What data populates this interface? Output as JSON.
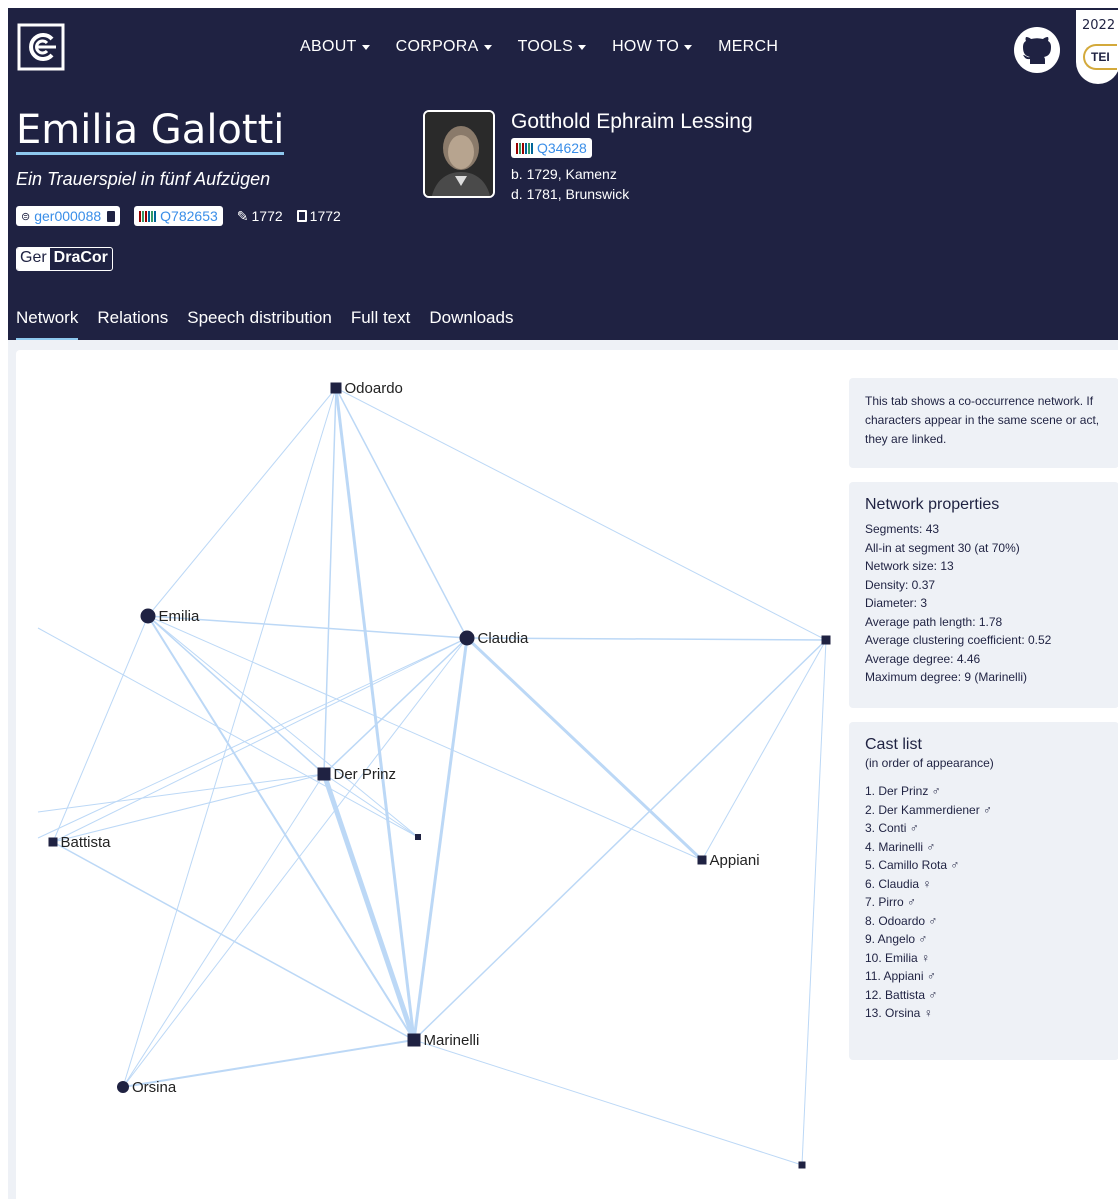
{
  "nav": {
    "items": [
      "ABOUT",
      "CORPORA",
      "TOOLS",
      "HOW TO",
      "MERCH"
    ],
    "has_caret": [
      true,
      true,
      true,
      true,
      false
    ]
  },
  "badge": {
    "year": "2022",
    "label": "TEI"
  },
  "play": {
    "title": "Emilia Galotti",
    "subtitle": "Ein Trauerspiel in fünf Aufzügen",
    "id": "ger000088",
    "wikidata": "Q782653",
    "written": "1772",
    "printed": "1772",
    "corpus_prefix": "Ger",
    "corpus_name": "DraCor"
  },
  "author": {
    "name": "Gotthold Ephraim Lessing",
    "wikidata": "Q34628",
    "born": "b. 1729, Kamenz",
    "died": "d. 1781, Brunswick"
  },
  "tabs": [
    "Network",
    "Relations",
    "Speech distribution",
    "Full text",
    "Downloads"
  ],
  "info": {
    "text": "This tab shows a co-occurrence network. If characters appear in the same scene or act, they are linked."
  },
  "network_properties": {
    "heading": "Network properties",
    "lines": [
      "Segments: 43",
      "All-in at segment 30 (at 70%)",
      "Network size: 13",
      "Density: 0.37",
      "Diameter: 3",
      "Average path length: 1.78",
      "Average clustering coefficient: 0.52",
      "Average degree: 4.46",
      "Maximum degree: 9 (Marinelli)"
    ]
  },
  "cast": {
    "heading": "Cast list",
    "subheading": "(in order of appearance)",
    "items": [
      "1. Der Prinz ♂",
      "2. Der Kammerdiener ♂",
      "3. Conti ♂",
      "4. Marinelli ♂",
      "5. Camillo Rota ♂",
      "6. Claudia ♀",
      "7. Pirro ♂",
      "8. Odoardo ♂",
      "9. Angelo ♂",
      "10. Emilia ♀",
      "11. Appiani ♂",
      "12. Battista ♂",
      "13. Orsina ♀"
    ]
  },
  "graph": {
    "nodes": [
      {
        "label": "Odoardo",
        "shape": "square"
      },
      {
        "label": "Emilia",
        "shape": "circle"
      },
      {
        "label": "Claudia",
        "shape": "circle"
      },
      {
        "label": "Der Prinz",
        "shape": "square"
      },
      {
        "label": "Battista",
        "shape": "square"
      },
      {
        "label": "Appiani",
        "shape": "square"
      },
      {
        "label": "Marinelli",
        "shape": "square"
      },
      {
        "label": "Orsina",
        "shape": "circle"
      },
      {
        "label": "",
        "shape": "square"
      },
      {
        "label": "",
        "shape": "square"
      },
      {
        "label": "",
        "shape": "square"
      }
    ]
  },
  "colors": {
    "background": "#1f2242",
    "accent": "#8ec8ee",
    "edge": "#bcd8f6",
    "node": "#1f2242"
  }
}
